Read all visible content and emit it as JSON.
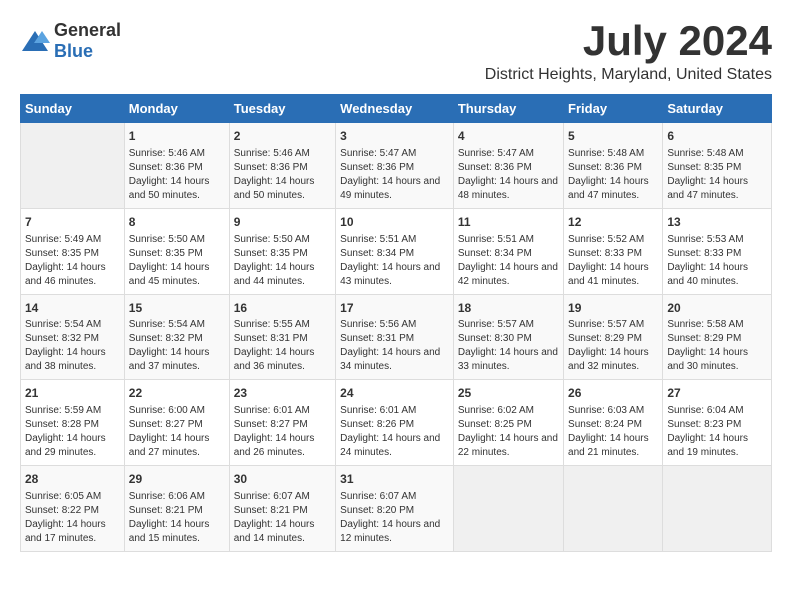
{
  "logo": {
    "general": "General",
    "blue": "Blue"
  },
  "title": "July 2024",
  "location": "District Heights, Maryland, United States",
  "days_of_week": [
    "Sunday",
    "Monday",
    "Tuesday",
    "Wednesday",
    "Thursday",
    "Friday",
    "Saturday"
  ],
  "weeks": [
    [
      {
        "day": "",
        "info": ""
      },
      {
        "day": "1",
        "info": "Sunrise: 5:46 AM\nSunset: 8:36 PM\nDaylight: 14 hours and 50 minutes."
      },
      {
        "day": "2",
        "info": "Sunrise: 5:46 AM\nSunset: 8:36 PM\nDaylight: 14 hours and 50 minutes."
      },
      {
        "day": "3",
        "info": "Sunrise: 5:47 AM\nSunset: 8:36 PM\nDaylight: 14 hours and 49 minutes."
      },
      {
        "day": "4",
        "info": "Sunrise: 5:47 AM\nSunset: 8:36 PM\nDaylight: 14 hours and 48 minutes."
      },
      {
        "day": "5",
        "info": "Sunrise: 5:48 AM\nSunset: 8:36 PM\nDaylight: 14 hours and 47 minutes."
      },
      {
        "day": "6",
        "info": "Sunrise: 5:48 AM\nSunset: 8:35 PM\nDaylight: 14 hours and 47 minutes."
      }
    ],
    [
      {
        "day": "7",
        "info": "Sunrise: 5:49 AM\nSunset: 8:35 PM\nDaylight: 14 hours and 46 minutes."
      },
      {
        "day": "8",
        "info": "Sunrise: 5:50 AM\nSunset: 8:35 PM\nDaylight: 14 hours and 45 minutes."
      },
      {
        "day": "9",
        "info": "Sunrise: 5:50 AM\nSunset: 8:35 PM\nDaylight: 14 hours and 44 minutes."
      },
      {
        "day": "10",
        "info": "Sunrise: 5:51 AM\nSunset: 8:34 PM\nDaylight: 14 hours and 43 minutes."
      },
      {
        "day": "11",
        "info": "Sunrise: 5:51 AM\nSunset: 8:34 PM\nDaylight: 14 hours and 42 minutes."
      },
      {
        "day": "12",
        "info": "Sunrise: 5:52 AM\nSunset: 8:33 PM\nDaylight: 14 hours and 41 minutes."
      },
      {
        "day": "13",
        "info": "Sunrise: 5:53 AM\nSunset: 8:33 PM\nDaylight: 14 hours and 40 minutes."
      }
    ],
    [
      {
        "day": "14",
        "info": "Sunrise: 5:54 AM\nSunset: 8:32 PM\nDaylight: 14 hours and 38 minutes."
      },
      {
        "day": "15",
        "info": "Sunrise: 5:54 AM\nSunset: 8:32 PM\nDaylight: 14 hours and 37 minutes."
      },
      {
        "day": "16",
        "info": "Sunrise: 5:55 AM\nSunset: 8:31 PM\nDaylight: 14 hours and 36 minutes."
      },
      {
        "day": "17",
        "info": "Sunrise: 5:56 AM\nSunset: 8:31 PM\nDaylight: 14 hours and 34 minutes."
      },
      {
        "day": "18",
        "info": "Sunrise: 5:57 AM\nSunset: 8:30 PM\nDaylight: 14 hours and 33 minutes."
      },
      {
        "day": "19",
        "info": "Sunrise: 5:57 AM\nSunset: 8:29 PM\nDaylight: 14 hours and 32 minutes."
      },
      {
        "day": "20",
        "info": "Sunrise: 5:58 AM\nSunset: 8:29 PM\nDaylight: 14 hours and 30 minutes."
      }
    ],
    [
      {
        "day": "21",
        "info": "Sunrise: 5:59 AM\nSunset: 8:28 PM\nDaylight: 14 hours and 29 minutes."
      },
      {
        "day": "22",
        "info": "Sunrise: 6:00 AM\nSunset: 8:27 PM\nDaylight: 14 hours and 27 minutes."
      },
      {
        "day": "23",
        "info": "Sunrise: 6:01 AM\nSunset: 8:27 PM\nDaylight: 14 hours and 26 minutes."
      },
      {
        "day": "24",
        "info": "Sunrise: 6:01 AM\nSunset: 8:26 PM\nDaylight: 14 hours and 24 minutes."
      },
      {
        "day": "25",
        "info": "Sunrise: 6:02 AM\nSunset: 8:25 PM\nDaylight: 14 hours and 22 minutes."
      },
      {
        "day": "26",
        "info": "Sunrise: 6:03 AM\nSunset: 8:24 PM\nDaylight: 14 hours and 21 minutes."
      },
      {
        "day": "27",
        "info": "Sunrise: 6:04 AM\nSunset: 8:23 PM\nDaylight: 14 hours and 19 minutes."
      }
    ],
    [
      {
        "day": "28",
        "info": "Sunrise: 6:05 AM\nSunset: 8:22 PM\nDaylight: 14 hours and 17 minutes."
      },
      {
        "day": "29",
        "info": "Sunrise: 6:06 AM\nSunset: 8:21 PM\nDaylight: 14 hours and 15 minutes."
      },
      {
        "day": "30",
        "info": "Sunrise: 6:07 AM\nSunset: 8:21 PM\nDaylight: 14 hours and 14 minutes."
      },
      {
        "day": "31",
        "info": "Sunrise: 6:07 AM\nSunset: 8:20 PM\nDaylight: 14 hours and 12 minutes."
      },
      {
        "day": "",
        "info": ""
      },
      {
        "day": "",
        "info": ""
      },
      {
        "day": "",
        "info": ""
      }
    ]
  ]
}
